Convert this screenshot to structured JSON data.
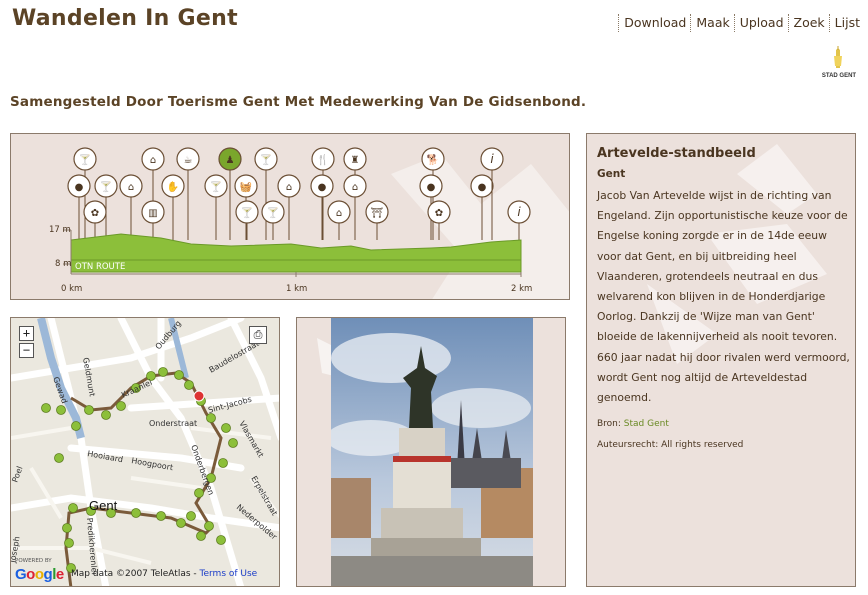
{
  "header": {
    "title": "Wandelen In Gent",
    "nav": [
      "Download",
      "Maak",
      "Upload",
      "Zoek",
      "Lijst"
    ],
    "logo_text": "STAD GENT"
  },
  "subtitle": "Samengesteld Door Toerisme Gent Met Medewerking Van De Gidsenbond.",
  "profile": {
    "route_label": "OTN ROUTE",
    "y_labels": [
      "17 m",
      "8 m"
    ],
    "x_labels": [
      "0 km",
      "1 km",
      "2 km"
    ],
    "colors": {
      "terrain": "#8cbf3a",
      "highlight": "#7aa62c",
      "pin_line": "#6b4f35"
    }
  },
  "map": {
    "zoom_in": "+",
    "zoom_out": "−",
    "city_label": "Gent",
    "streets": [
      "Oudburg",
      "Geldmunt",
      "Kraanlei",
      "Baudelostraat",
      "Sint-Jacobs",
      "Onderstraat",
      "Vlasmarkt",
      "Hooiaard",
      "Hoogpoort",
      "Onderbergen",
      "Poel",
      "Predikherenlei",
      "Nederpolder",
      "Erpelstraat",
      "Gewad",
      "Joseph"
    ],
    "powered_by": "POWERED BY",
    "google": "Google",
    "attribution": "Map data ©2007 TeleAtlas - ",
    "terms": "Terms of Use"
  },
  "info": {
    "title": "Artevelde-standbeeld",
    "city": "Gent",
    "body": "Jacob Van Artevelde wijst in de richting van Engeland. Zijn opportunistische keuze voor de Engelse koning zorgde er in de 14de eeuw voor dat Gent, en bij uitbreiding heel Vlaanderen, grotendeels neutraal en dus welvarend kon blijven in de Honderdjarige Oorlog. Dankzij de 'Wijze man van Gent' bloeide de lakennijverheid als nooit tevoren. 660 jaar nadat hij door rivalen werd vermoord, wordt Gent nog altijd de Arteveldestad genoemd.",
    "source_label": "Bron: ",
    "source_link": "Stad Gent",
    "copyright": "Auteursrecht: All rights reserved"
  }
}
